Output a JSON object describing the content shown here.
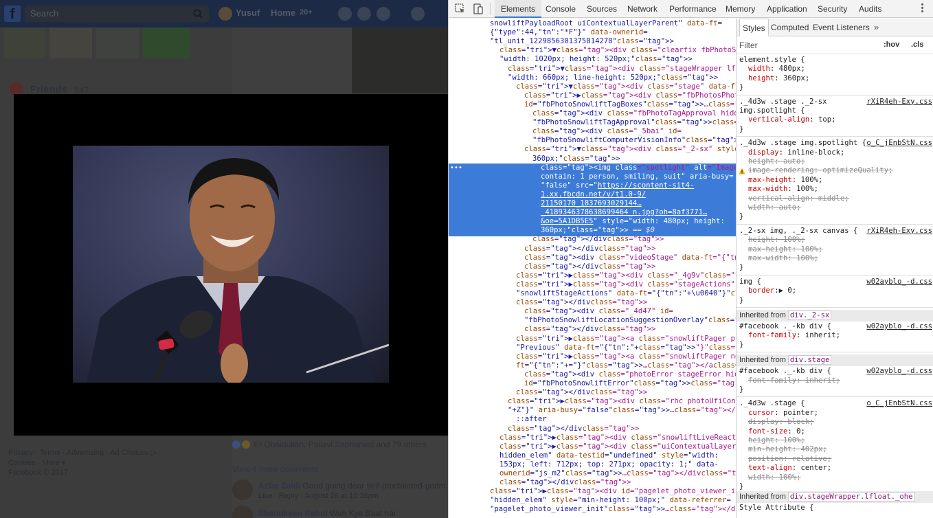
{
  "facebook": {
    "search_placeholder": "Search",
    "user_name": "Yusuf",
    "home_label": "Home",
    "home_count": "20+",
    "friends_label": "Friends",
    "friends_count": "947",
    "footer_links": [
      "Privacy · Terms · Advertising · Ad Choices ▷ ·",
      "Cookies · More ▾",
      "Facebook © 2017"
    ],
    "reactions_text": "Er Obaidullah, Pallavi Sabharwal and 79 others",
    "view_more_comments": "View 4 more comments",
    "comments": [
      {
        "author": "Azfar Zaidi",
        "text": " Good going dear self-proclaimed-godm",
        "meta": "Like · Reply · August 26 at 10:38pm"
      },
      {
        "author": "Shaunkeen Rahul",
        "text": " Wah Kya Baat hai ",
        "meta": ""
      }
    ]
  },
  "photo_viewer": {
    "image_alt": "Image may contain: 1 person, smiling, suit"
  },
  "devtools": {
    "tabs": [
      "Elements",
      "Console",
      "Sources",
      "Network",
      "Performance",
      "Memory",
      "Application",
      "Security",
      "Audits"
    ],
    "active_tab": "Elements",
    "styles_tabs": [
      "Styles",
      "Computed",
      "Event Listeners"
    ],
    "more_tabs": "»",
    "filter_placeholder": "Filter",
    "hov": ":hov",
    "cls": ".cls",
    "dom_lines": [
      "snowliftPayloadRoot uiContextualLayerParent\" data-ft=",
      "{\"type\":44,\"tn\":\"*F\"}\" data-ownerid=",
      "\"tl_unit_1229856301375814278\">",
      "▼<div class=\"clearfix fbPhotoSnowliftPopup\" style=",
      "\"width: 1020px; height: 520px;\">",
      "▼<div class=\"stageWrapper lfloat _ohe\" style=",
      "\"width: 660px; line-height: 520px;\">",
      "▼<div class=\"stage\" data-ft=\"{\"tn\":\"E\"}\">",
      "▶<div class=\"fbPhotosPhotoTagboxes tagContainer\"",
      "id=\"fbPhotoSnowliftTagBoxes\">…</div>",
      "<div class=\"fbPhotoTagApproval hidden_elem\" id=",
      "\"fbPhotoSnowliftTagApproval\"></div>",
      "<div class=\"_5bai\" id=",
      "\"fbPhotoSnowliftComputerVisionInfo\"></div>",
      "▼<div class=\"_2-sx\" style=\"width: 480px; height:",
      "360px;\">",
      "<img class=\"spotlight\" alt=\"Image may",
      "contain: 1 person, smiling, suit\" aria-busy=",
      "\"false\" src=\"https://scontent-sit4-",
      "1.xx.fbcdn.net/v/t1.0-9/",
      "21150170_1837693029144…",
      "_4189346378638699464_n.jpg?oh=8af3771…",
      "&oe=5A1DB5E5\" style=\"width: 480px; height:",
      "360px;\"> == $0",
      "</div>",
      "</div>",
      "<div class=\"videoStage\" data-ft=\"{\"tn\":\"F\"}\">",
      "</div>",
      "▶<div class=\"_4g9v\">…</div>",
      "▶<div class=\"stageActions\" id=",
      "\"snowliftStageActions\" data-ft=\"{\"tn\":\"+\\u0040\"}\">…",
      "</div>",
      "<div class=\"_4d47\" id=",
      "\"fbPhotoSnowliftLocationSuggestionOverlay\">",
      "</div>",
      "▶<a class=\"snowliftPager prev hilightPager\" title=",
      "\"Previous\" data-ft=\"{\"tn\":\"+>\"}\">…</a>",
      "▶<a class=\"snowliftPager next\" title=\"Next\" data-",
      "ft=\"{\"tn\":\"+=\"}\">…</a>",
      "<div class=\"photoError stageError hidden_elem\"",
      "id=\"fbPhotoSnowliftError\"></div>",
      "</div>",
      "▶<div class=\"rhc photoUfiContainer\" data-ft=\"{\"tn\":",
      "\"+Z\"}\" aria-busy=\"false\">…</div>",
      "::after",
      "</div>",
      "▶<div class=\"snowliftLiveReactionsStage\" id=\"u_i_3\">…",
      "▶<div class=\"uiContextualLayerPositioner uiLayer",
      "hidden_elem\" data-testid=\"undefined\" style=\"width:",
      "153px; left: 712px; top: 271px; opacity: 1;\" data-",
      "ownerid=\"js_m2\">…</div>",
      "</div>",
      "▶<div id=\"pagelet_photo_viewer_init\" class=",
      "\"hidden_elem\" style=\"min-height: 100px;\" data-referrer=",
      "\"pagelet_photo_viewer_init\">…</div>"
    ],
    "styles": {
      "element_style_selector": "element.style {",
      "element_style_props": [
        "width: 480px;",
        "height: 360px;"
      ],
      "rule1_selector": [
        "._4d3w .stage ._2-sx",
        "img.spotlight {"
      ],
      "rule1_source": "rXiR4eh-Exy.css",
      "rule1_props": [
        "vertical-align: top;"
      ],
      "rule2_selector": "._4d3w .stage img.spotlight {",
      "rule2_source": "o_C_jEnbStN.css",
      "rule2_props": [
        "display: inline-block;",
        "height: auto;",
        "image-rendering: optimizeQuality;",
        "max-height: 100%;",
        "max-width: 100%;",
        "vertical-align: middle;",
        "width: auto;"
      ],
      "rule3_selector": "._2-sx img, ._2-sx canvas {",
      "rule3_source": "rXiR4eh-Exy.css",
      "rule3_props": [
        "height: 100%;",
        "max-height: 100%;",
        "max-width: 100%;"
      ],
      "rule4_selector": "img {",
      "rule4_source": "w02ayblo_-d.css",
      "rule4_props": [
        "border:▶ 0;"
      ],
      "inherited_label": "Inherited from",
      "inherited1": "div._2-sx",
      "rule5_selector": "#facebook ._-kb div {",
      "rule5_source": "w02ayblo_-d.css",
      "rule5_props": [
        "font-family: inherit;"
      ],
      "inherited2": "div.stage",
      "rule6_selector": "#facebook ._-kb div {",
      "rule6_source": "w02ayblo_-d.css",
      "rule6_props": [
        "font-family: inherit;"
      ],
      "rule7_selector": "._4d3w .stage {",
      "rule7_source": "o_C_jEnbStN.css",
      "rule7_props": [
        "cursor: pointer;",
        "display: block;",
        "font-size: 0;",
        "height: 100%;",
        "min-height: 402px;",
        "position: relative;",
        "text-align: center;",
        "width: 100%;"
      ],
      "inherited3": "div.stageWrapper.lfloat._ohe",
      "style_attribute": "Style Attribute {"
    }
  }
}
